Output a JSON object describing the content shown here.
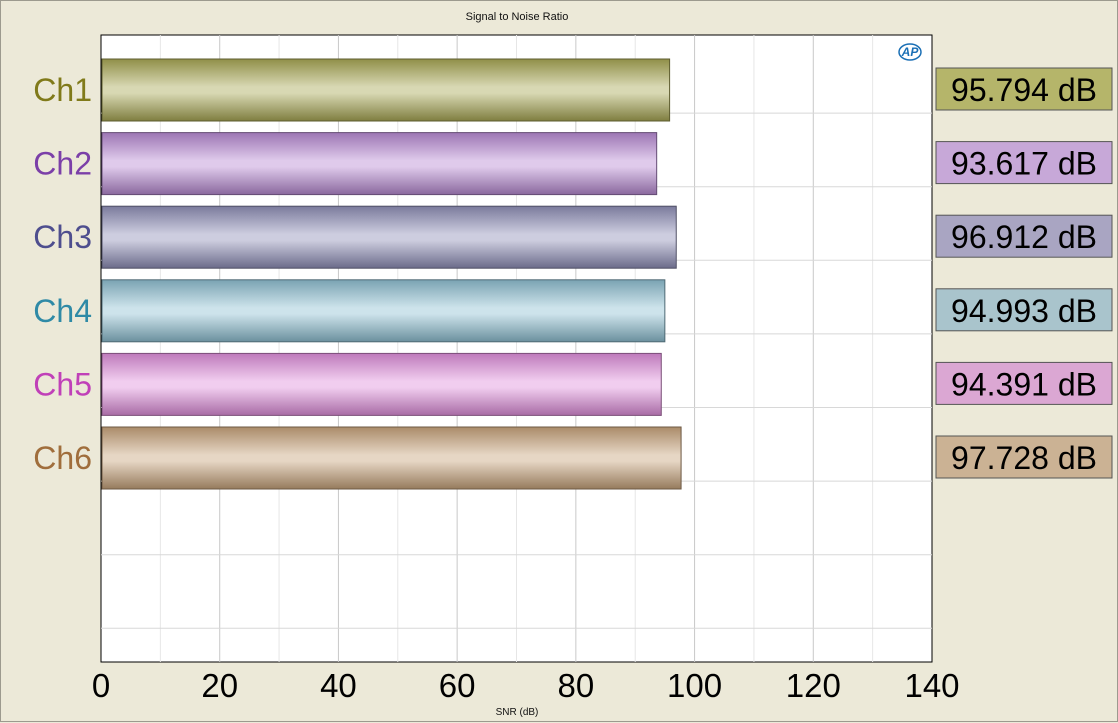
{
  "chart_data": {
    "type": "bar",
    "orientation": "horizontal",
    "title": "Signal to Noise Ratio",
    "xlabel": "SNR (dB)",
    "ylabel": "",
    "xlim": [
      0,
      140
    ],
    "x_ticks": [
      "0",
      "20",
      "40",
      "60",
      "80",
      "100",
      "120",
      "140"
    ],
    "categories": [
      "Ch1",
      "Ch2",
      "Ch3",
      "Ch4",
      "Ch5",
      "Ch6"
    ],
    "values": [
      95.794,
      93.617,
      96.912,
      94.993,
      94.391,
      97.728
    ],
    "value_labels": [
      "95.794 dB",
      "93.617 dB",
      "96.912 dB",
      "94.993 dB",
      "94.391 dB",
      "97.728 dB"
    ],
    "colors": [
      "#a9a855",
      "#b88ad2",
      "#8f8fb8",
      "#8fc0d2",
      "#e08fdc",
      "#c8a47c"
    ],
    "label_colors": [
      "#807a1a",
      "#7b3fa8",
      "#4e4e8e",
      "#2f8aa6",
      "#c040b8",
      "#a06e3c"
    ],
    "box_colors": [
      "#b5b56a",
      "#c7a8d8",
      "#a9a5c2",
      "#a9c4cc",
      "#dba7d3",
      "#cbb294"
    ],
    "grid": true,
    "legend": "none",
    "logo": "AP"
  }
}
